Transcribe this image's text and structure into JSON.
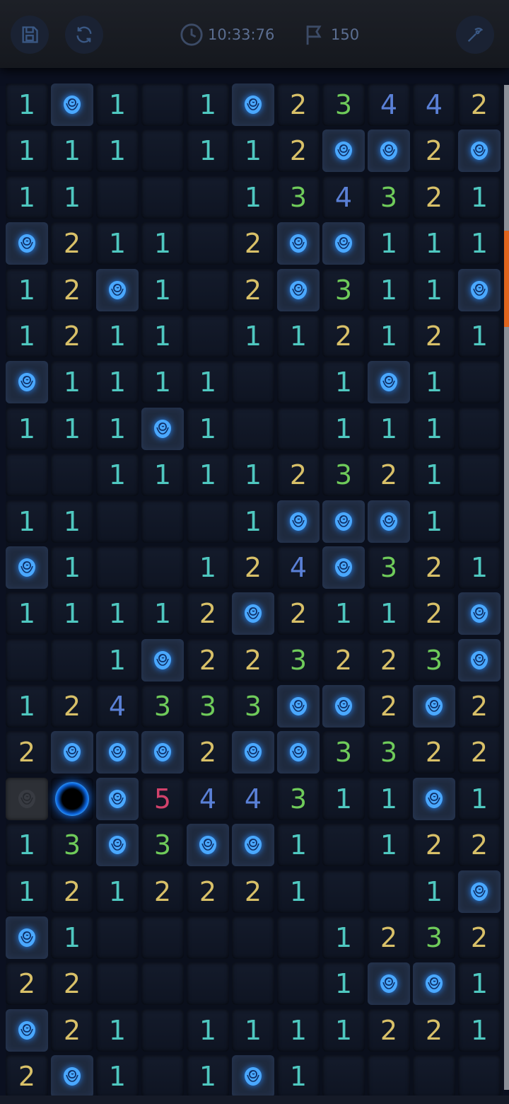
{
  "toolbar": {
    "save_icon": "save-icon",
    "restart_icon": "restart-icon",
    "timer_icon": "clock-icon",
    "timer": "10:33:76",
    "flag_icon": "flag-icon",
    "flags": "150",
    "tool_icon": "pickaxe-icon"
  },
  "board": {
    "columns": 11,
    "rows": 22,
    "mine_icon": "rose-icon",
    "cells": [
      [
        "1",
        "M",
        "1",
        "",
        "1",
        "M",
        "2",
        "3",
        "4",
        "4",
        "2"
      ],
      [
        "1",
        "1",
        "1",
        "",
        "1",
        "1",
        "2",
        "M",
        "M",
        "2",
        "M"
      ],
      [
        "1",
        "1",
        "",
        "",
        "",
        "1",
        "3",
        "4",
        "3",
        "2",
        "1"
      ],
      [
        "M",
        "2",
        "1",
        "1",
        "",
        "2",
        "M",
        "M",
        "1",
        "1",
        "1"
      ],
      [
        "1",
        "2",
        "M",
        "1",
        "",
        "2",
        "M",
        "3",
        "1",
        "1",
        "M"
      ],
      [
        "1",
        "2",
        "1",
        "1",
        "",
        "1",
        "1",
        "2",
        "1",
        "2",
        "1"
      ],
      [
        "M",
        "1",
        "1",
        "1",
        "1",
        "",
        "",
        "1",
        "M",
        "1",
        ""
      ],
      [
        "1",
        "1",
        "1",
        "M",
        "1",
        "",
        "",
        "1",
        "1",
        "1",
        ""
      ],
      [
        "",
        "",
        "1",
        "1",
        "1",
        "1",
        "2",
        "3",
        "2",
        "1",
        ""
      ],
      [
        "1",
        "1",
        "",
        "",
        "",
        "1",
        "M",
        "M",
        "M",
        "1",
        ""
      ],
      [
        "M",
        "1",
        "",
        "",
        "1",
        "2",
        "4",
        "M",
        "3",
        "2",
        "1"
      ],
      [
        "1",
        "1",
        "1",
        "1",
        "2",
        "M",
        "2",
        "1",
        "1",
        "2",
        "M"
      ],
      [
        "",
        "",
        "1",
        "M",
        "2",
        "2",
        "3",
        "2",
        "2",
        "3",
        "M"
      ],
      [
        "1",
        "2",
        "4",
        "3",
        "3",
        "3",
        "M",
        "M",
        "2",
        "M",
        "2"
      ],
      [
        "2",
        "M",
        "M",
        "M",
        "2",
        "M",
        "M",
        "3",
        "3",
        "2",
        "2"
      ],
      [
        "D",
        "H",
        "M",
        "5",
        "4",
        "4",
        "3",
        "1",
        "1",
        "M",
        "1"
      ],
      [
        "1",
        "3",
        "M",
        "3",
        "M",
        "M",
        "1",
        "",
        "1",
        "2",
        "2"
      ],
      [
        "1",
        "2",
        "1",
        "2",
        "2",
        "2",
        "1",
        "",
        "",
        "1",
        "M"
      ],
      [
        "M",
        "1",
        "",
        "",
        "",
        "",
        "",
        "1",
        "2",
        "3",
        "2"
      ],
      [
        "2",
        "2",
        "",
        "",
        "",
        "",
        "",
        "1",
        "M",
        "M",
        "1"
      ],
      [
        "M",
        "2",
        "1",
        "",
        "1",
        "1",
        "1",
        "1",
        "2",
        "2",
        "1"
      ],
      [
        "2",
        "M",
        "1",
        "",
        "1",
        "M",
        "1",
        "",
        "",
        "",
        ""
      ]
    ]
  },
  "colors": {
    "n1": "#4fc8c0",
    "n2": "#d8c068",
    "n3": "#6fcb5a",
    "n4": "#5a80d6",
    "n5": "#d2426b",
    "accent": "#e0651e"
  }
}
